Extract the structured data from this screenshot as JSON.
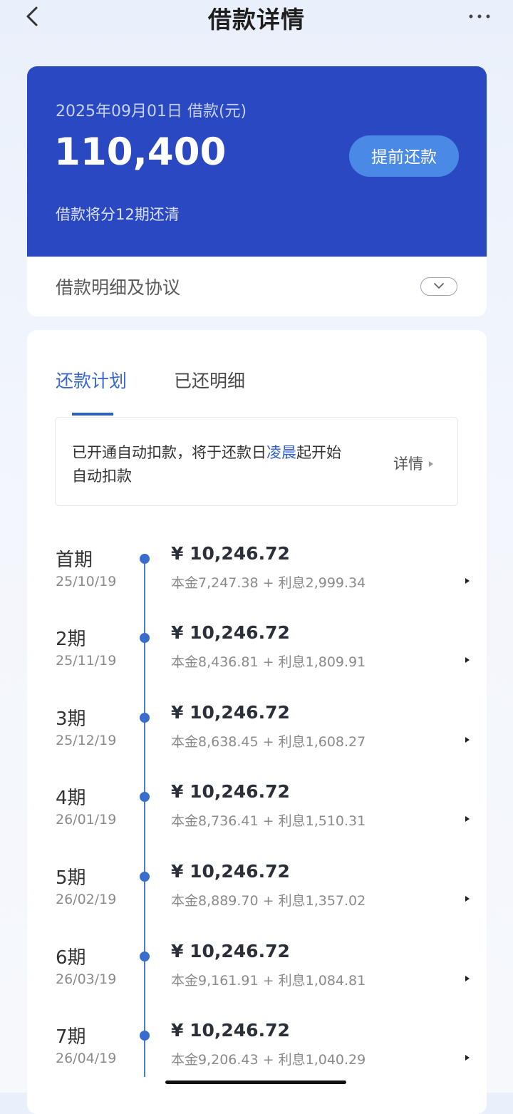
{
  "nav": {
    "title": "借款详情",
    "back_icon": "chevron-left-icon",
    "more_icon": "more-dots-icon"
  },
  "loan": {
    "date_label": "2025年09月01日 借款(元)",
    "amount": "110,400",
    "prepay_label": "提前还款",
    "periods_note": "借款将分12期还清",
    "detail_label": "借款明细及协议",
    "brand_color": "#2a48c2",
    "button_color": "#4a89e6"
  },
  "tabs": [
    {
      "label": "还款计划",
      "active": true
    },
    {
      "label": "已还明细",
      "active": false
    }
  ],
  "notice": {
    "text_before": "已开通自动扣款，将于还款日",
    "highlight": "凌晨",
    "text_after": "起开始",
    "line2": "自动扣款",
    "detail_link": "详情"
  },
  "schedule": [
    {
      "label": "首期",
      "date": "25/10/19",
      "amount": "¥ 10,246.72",
      "breakdown": "本金7,247.38 + 利息2,999.34"
    },
    {
      "label": "2期",
      "date": "25/11/19",
      "amount": "¥ 10,246.72",
      "breakdown": "本金8,436.81 + 利息1,809.91"
    },
    {
      "label": "3期",
      "date": "25/12/19",
      "amount": "¥ 10,246.72",
      "breakdown": "本金8,638.45 + 利息1,608.27"
    },
    {
      "label": "4期",
      "date": "26/01/19",
      "amount": "¥ 10,246.72",
      "breakdown": "本金8,736.41 + 利息1,510.31"
    },
    {
      "label": "5期",
      "date": "26/02/19",
      "amount": "¥ 10,246.72",
      "breakdown": "本金8,889.70 + 利息1,357.02"
    },
    {
      "label": "6期",
      "date": "26/03/19",
      "amount": "¥ 10,246.72",
      "breakdown": "本金9,161.91 + 利息1,084.81"
    },
    {
      "label": "7期",
      "date": "26/04/19",
      "amount": "¥ 10,246.72",
      "breakdown": "本金9,206.43 + 利息1,040.29"
    }
  ]
}
